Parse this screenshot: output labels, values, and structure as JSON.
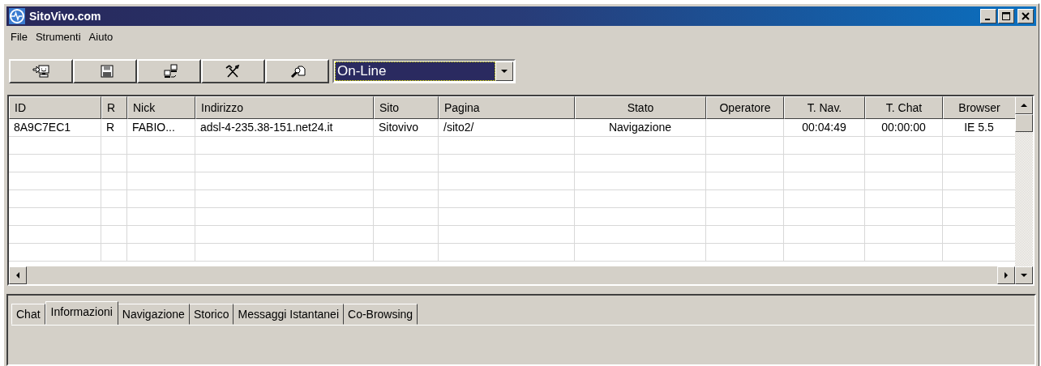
{
  "window": {
    "title": "SitoVivo.com"
  },
  "menu": [
    "File",
    "Strumenti",
    "Aiuto"
  ],
  "toolbar": {
    "buttons": [
      {
        "kind": "monitor-arrow"
      },
      {
        "kind": "floppy"
      },
      {
        "kind": "network"
      },
      {
        "kind": "tools"
      },
      {
        "kind": "magnifier"
      }
    ],
    "status_dropdown": {
      "value": "On-Line"
    }
  },
  "table": {
    "columns": [
      {
        "label": "ID"
      },
      {
        "label": "R"
      },
      {
        "label": "Nick"
      },
      {
        "label": "Indirizzo"
      },
      {
        "label": "Sito"
      },
      {
        "label": "Pagina"
      },
      {
        "label": "Stato"
      },
      {
        "label": "Operatore"
      },
      {
        "label": "T. Nav."
      },
      {
        "label": "T. Chat"
      },
      {
        "label": "Browser"
      }
    ],
    "rows": [
      {
        "cells": [
          "8A9C7EC1",
          "R",
          "FABIO...",
          "adsl-4-235.38-151.net24.it",
          "Sitovivo",
          "/sito2/",
          "Navigazione",
          null,
          "00:04:49",
          "00:00:00",
          "IE 5.5"
        ]
      }
    ]
  },
  "tabs": [
    {
      "label": "Chat",
      "selected": false
    },
    {
      "label": "Informazioni",
      "selected": true
    },
    {
      "label": "Navigazione",
      "selected": false
    },
    {
      "label": "Storico",
      "selected": false
    },
    {
      "label": "Messaggi Istantanei",
      "selected": false
    },
    {
      "label": "Co-Browsing",
      "selected": false
    }
  ]
}
